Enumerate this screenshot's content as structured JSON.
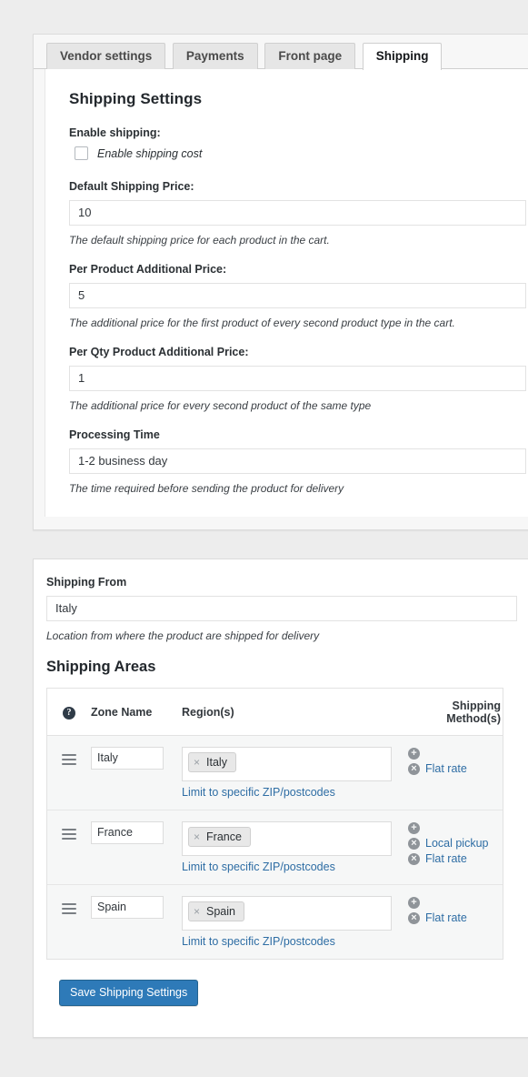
{
  "tabs": [
    {
      "label": "Vendor settings",
      "active": false
    },
    {
      "label": "Payments",
      "active": false
    },
    {
      "label": "Front page",
      "active": false
    },
    {
      "label": "Shipping",
      "active": true
    }
  ],
  "shipping_settings": {
    "title": "Shipping Settings",
    "enable": {
      "label": "Enable shipping:",
      "checkbox_label": "Enable shipping cost",
      "checked": false
    },
    "default_price": {
      "label": "Default Shipping Price:",
      "value": "10",
      "help": "The default shipping price for each product in the cart."
    },
    "per_product_price": {
      "label": "Per Product Additional Price:",
      "value": "5",
      "help": "The additional price for the first product of every second product type in the cart."
    },
    "per_qty_price": {
      "label": "Per Qty Product Additional Price:",
      "value": "1",
      "help": "The additional price for every second product of the same type"
    },
    "processing_time": {
      "label": "Processing Time",
      "value": "1-2 business day",
      "help": "The time required before sending the product for delivery"
    }
  },
  "shipping_from": {
    "label": "Shipping From",
    "value": "Italy",
    "help": "Location from where the product are shipped for delivery"
  },
  "shipping_areas": {
    "title": "Shipping Areas",
    "help_icon": "help-icon",
    "columns": {
      "handle": "",
      "zone_name": "Zone Name",
      "regions": "Region(s)",
      "methods": "Shipping Method(s)"
    },
    "zip_link_label": "Limit to specific ZIP/postcodes",
    "add_icon": "plus-circle-icon",
    "remove_icon": "remove-circle-icon",
    "drag_icon": "drag-handle-icon",
    "rows": [
      {
        "zone_name": "Italy",
        "regions": [
          "Italy"
        ],
        "methods": [
          "Flat rate"
        ]
      },
      {
        "zone_name": "France",
        "regions": [
          "France"
        ],
        "methods": [
          "Local pickup",
          "Flat rate"
        ]
      },
      {
        "zone_name": "Spain",
        "regions": [
          "Spain"
        ],
        "methods": [
          "Flat rate"
        ]
      }
    ]
  },
  "save_button": {
    "label": "Save Shipping Settings",
    "color": "#2e7ab8"
  },
  "colors": {
    "page_background": "#ededed",
    "panel_background": "#ffffff",
    "link": "#2e6da4",
    "row_background": "#f6f7f7",
    "accent": "#2e7ab8"
  }
}
